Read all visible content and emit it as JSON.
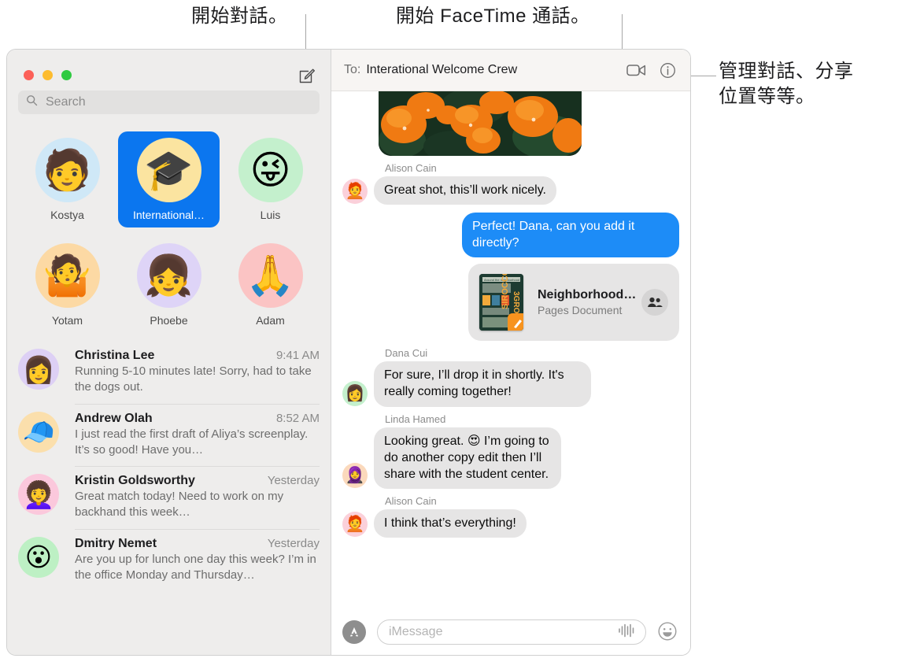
{
  "annotations": {
    "compose": "開始對話。",
    "facetime": "開始 FaceTime 通話。",
    "info": "管理對話、分享\n位置等等。"
  },
  "window": {
    "traffic_lights": {
      "close_label": "Close",
      "minimize_label": "Minimize",
      "zoom_label": "Zoom"
    },
    "compose_icon": "compose-icon"
  },
  "sidebar": {
    "search": {
      "placeholder": "Search",
      "value": "",
      "icon": "search-icon"
    },
    "pinned": [
      {
        "name": "Kostya",
        "avatar": "🧑",
        "bg": "#cfe8f7",
        "selected": false
      },
      {
        "name": "International…",
        "avatar": "🎓",
        "bg": "#fbe4a0",
        "selected": true
      },
      {
        "name": "Luis",
        "avatar": "😜",
        "bg": "#c4f0cd",
        "selected": false
      },
      {
        "name": "Yotam",
        "avatar": "🤷",
        "bg": "#fcd9a4",
        "selected": false
      },
      {
        "name": "Phoebe",
        "avatar": "👧",
        "bg": "#ded4f7",
        "selected": false
      },
      {
        "name": "Adam",
        "avatar": "🙏",
        "bg": "#fbc4c4",
        "selected": false
      }
    ],
    "conversations": [
      {
        "name": "Christina Lee",
        "time": "9:41 AM",
        "snippet": "Running 5-10 minutes late! Sorry, had to take the dogs out.",
        "avatar": "👩",
        "bg": "#ddd0f5"
      },
      {
        "name": "Andrew Olah",
        "time": "8:52 AM",
        "snippet": "I just read the first draft of Aliya’s screenplay. It’s so good! Have you…",
        "avatar": "🧢",
        "bg": "#fbdfac"
      },
      {
        "name": "Kristin Goldsworthy",
        "time": "Yesterday",
        "snippet": "Great match today! Need to work on my backhand this week…",
        "avatar": "👩‍🦱",
        "bg": "#fbc8dc"
      },
      {
        "name": "Dmitry Nemet",
        "time": "Yesterday",
        "snippet": "Are you up for lunch one day this week? I’m in the office Monday and Thursday…",
        "avatar": "😮",
        "bg": "#bdf0c4"
      }
    ]
  },
  "thread": {
    "to_label": "To:",
    "recipient": "Interational Welcome Crew",
    "facetime_icon": "video-camera-icon",
    "info_icon": "info-circle-icon",
    "messages": [
      {
        "kind": "photo",
        "alt": "orange-flowers-photo"
      },
      {
        "kind": "text",
        "side": "them",
        "sender": "Alison Cain",
        "text": "Great shot, this’ll work nicely.",
        "avatar": "🧑‍🦰",
        "bg": "#fbd0da",
        "show_avatar": true
      },
      {
        "kind": "text",
        "side": "me",
        "sender": "",
        "text": "Perfect! Dana, can you add it directly?"
      },
      {
        "kind": "doc",
        "side": "me",
        "title": "Neighborhood…",
        "subtitle": "Pages Document",
        "app_icon": "pages-icon",
        "people_icon": "people-icon"
      },
      {
        "kind": "text",
        "side": "them",
        "sender": "Dana Cui",
        "text": "For sure, I’ll drop it in shortly. It's really coming together!",
        "avatar": "👩",
        "bg": "#c4f0cd",
        "show_avatar": true
      },
      {
        "kind": "text",
        "side": "them",
        "sender": "Linda Hamed",
        "text": "Looking great. 😍 I’m going to do another copy edit then I’ll share with the student center.",
        "avatar": "🧕",
        "bg": "#fbd9bc",
        "show_avatar": true
      },
      {
        "kind": "text",
        "side": "them",
        "sender": "Alison Cain",
        "text": "I think that’s everything!",
        "avatar": "🧑‍🦰",
        "bg": "#fbd0da",
        "show_avatar": true
      }
    ],
    "composer": {
      "apps_icon": "app-store-icon",
      "placeholder": "iMessage",
      "value": "",
      "audio_icon": "audio-waveform-icon",
      "emoji_icon": "smiley-face-icon"
    }
  },
  "colors": {
    "accent_blue": "#0b76ef",
    "bubble_me": "#1d8cf7",
    "bubble_them": "#e6e5e5",
    "sidebar_bg": "#eeedec",
    "header_bg": "#f7f5f3"
  }
}
